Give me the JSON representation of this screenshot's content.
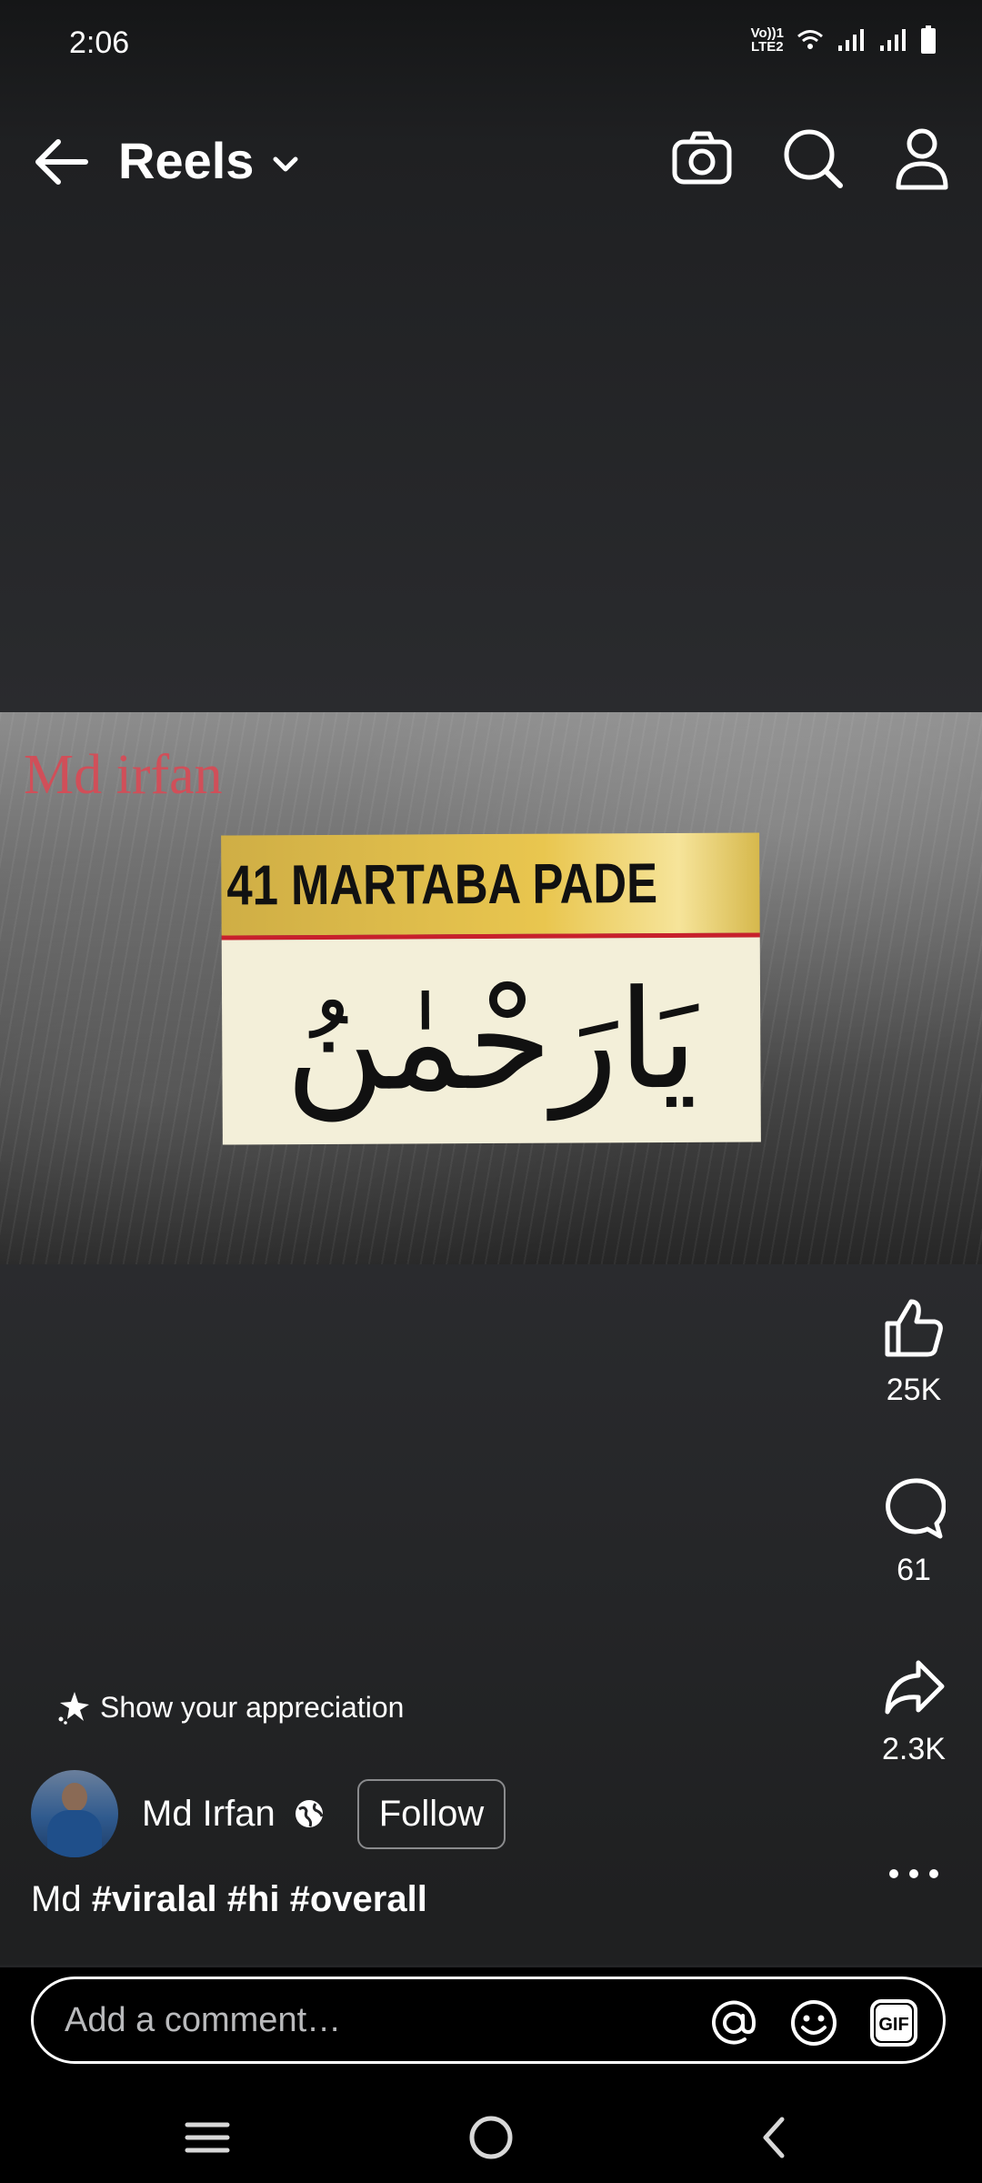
{
  "status_bar": {
    "time": "2:06",
    "volte_line1": "Vo))1",
    "volte_line2": "LTE2"
  },
  "header": {
    "title": "Reels"
  },
  "video": {
    "watermark": "Md irfan",
    "card_caption": "41 MARTABA PADE",
    "arabic_text": "يَارَحْمٰنُ"
  },
  "actions": {
    "likes": "25K",
    "comments": "61",
    "shares": "2.3K"
  },
  "appreciation": {
    "label": "Show your appreciation"
  },
  "post": {
    "author": "Md Irfan",
    "follow_label": "Follow",
    "caption_prefix": "Md ",
    "hashtags": [
      "#viralal",
      "#hi",
      "#overall"
    ]
  },
  "comment": {
    "placeholder": "Add a comment…"
  },
  "icons": {
    "back": "arrow-left-icon",
    "dropdown": "chevron-down-icon",
    "camera": "camera-icon",
    "search": "search-icon",
    "profile": "person-icon",
    "like": "thumbs-up-icon",
    "comment": "speech-bubble-icon",
    "share": "share-arrow-icon",
    "more": "ellipsis-icon",
    "mention": "at-sign-icon",
    "emoji": "smiley-icon",
    "gif": "gif-icon"
  }
}
